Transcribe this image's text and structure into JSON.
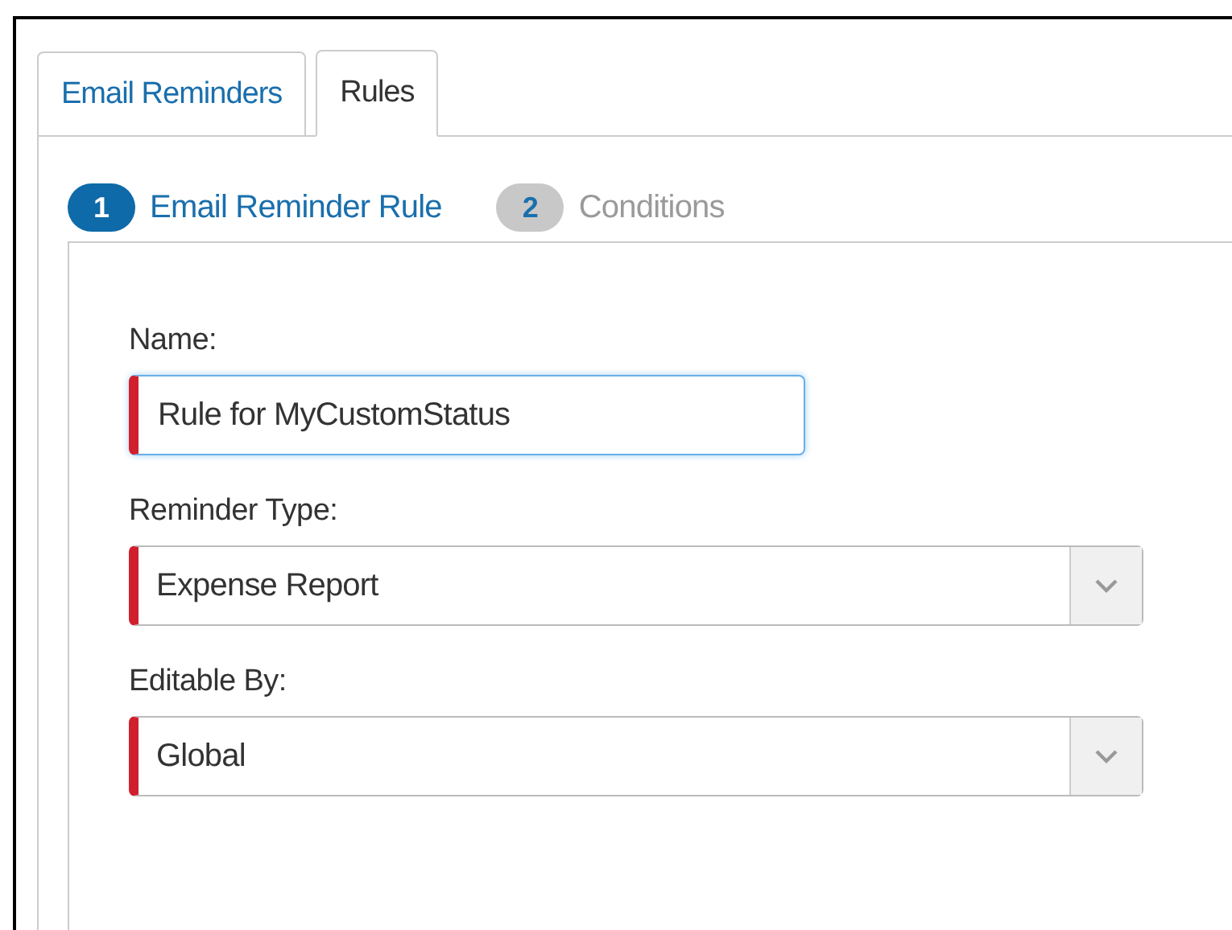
{
  "tabs": [
    {
      "label": "Email Reminders",
      "selected": false
    },
    {
      "label": "Rules",
      "selected": true
    }
  ],
  "steps": [
    {
      "number": "1",
      "label": "Email Reminder Rule",
      "selected": true
    },
    {
      "number": "2",
      "label": "Conditions",
      "selected": false
    }
  ],
  "fields": [
    {
      "kind": "text",
      "label": "Name:",
      "value": "Rule for MyCustomStatus",
      "required": true,
      "focused": true
    },
    {
      "kind": "select",
      "label": "Reminder Type:",
      "value": "Expense Report",
      "required": true,
      "focused": false
    },
    {
      "kind": "select",
      "label": "Editable By:",
      "value": "Global",
      "required": true,
      "focused": false
    }
  ]
}
